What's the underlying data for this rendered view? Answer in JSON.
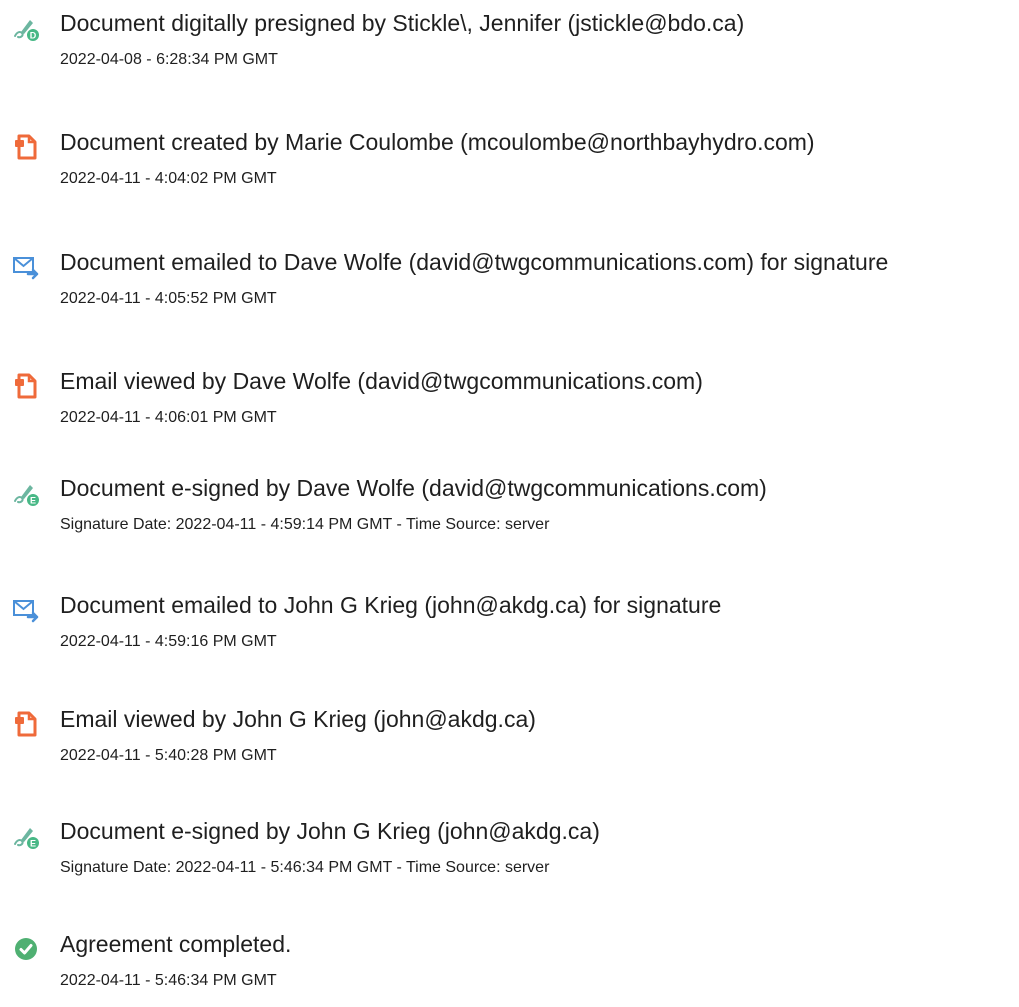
{
  "colors": {
    "pen": "#6cb6a0",
    "pen_badge": "#48b886",
    "doc": "#ef6a3a",
    "mail": "#4a90d9",
    "check": "#4fb072"
  },
  "events": [
    {
      "icon": "pen-sign-icon",
      "badge": "D",
      "title": "Document digitally presigned by Stickle\\, Jennifer (jstickle@bdo.ca)",
      "sub": "2022-04-08 - 6:28:34 PM GMT"
    },
    {
      "icon": "document-icon",
      "title": "Document created by Marie Coulombe (mcoulombe@northbayhydro.com)",
      "sub": "2022-04-11 - 4:04:02 PM GMT"
    },
    {
      "icon": "email-icon",
      "title": "Document emailed to Dave Wolfe (david@twgcommunications.com) for signature",
      "sub": "2022-04-11 - 4:05:52 PM GMT"
    },
    {
      "icon": "document-icon",
      "title": "Email viewed by Dave Wolfe (david@twgcommunications.com)",
      "sub": "2022-04-11 - 4:06:01 PM GMT"
    },
    {
      "icon": "pen-sign-icon",
      "badge": "E",
      "title": "Document e-signed by Dave Wolfe (david@twgcommunications.com)",
      "sub": "Signature Date: 2022-04-11 - 4:59:14 PM GMT - Time Source: server"
    },
    {
      "icon": "email-icon",
      "title": "Document emailed to John G Krieg (john@akdg.ca) for signature",
      "sub": "2022-04-11 - 4:59:16 PM GMT"
    },
    {
      "icon": "document-icon",
      "title": "Email viewed by John G Krieg (john@akdg.ca)",
      "sub": "2022-04-11 - 5:40:28 PM GMT"
    },
    {
      "icon": "pen-sign-icon",
      "badge": "E",
      "title": "Document e-signed by John G Krieg (john@akdg.ca)",
      "sub": "Signature Date: 2022-04-11 - 5:46:34 PM GMT - Time Source: server"
    },
    {
      "icon": "checkmark-circle-icon",
      "title": "Agreement completed.",
      "sub": "2022-04-11 - 5:46:34 PM GMT"
    }
  ]
}
